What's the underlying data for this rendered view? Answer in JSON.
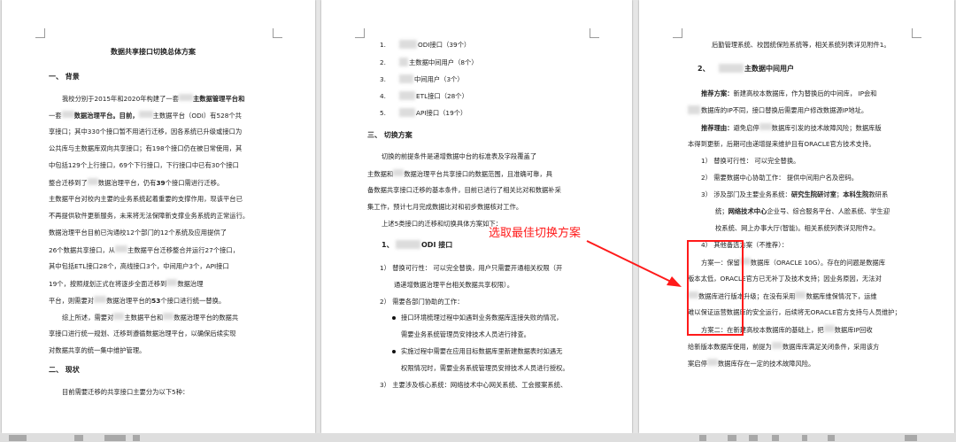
{
  "annotation": {
    "text": "选取最佳切换方案",
    "color": "#ff1a1a"
  },
  "page1": {
    "title": "数据共享接口切换总体方案",
    "s1_heading": "一、 背景",
    "p1": [
      "我校分别于2015年和2020年构建了一套",
      "主数据管理平台和",
      "一套",
      "数据治理平台。目前，",
      "主数据平台（ODI）有528个共",
      "享接口；其中330个接口暂不用进行迁移，因各系统已升级或接口为",
      "公共库与主数据库双向共享接口；有198个接口仍在被日常使用，其",
      "中包括129个上行接口，69个下行接口，下行接口中已有30个接口",
      "整合迁移到了",
      "数据治理平台，仍有",
      "39",
      "个接口需进行迁移。",
      "主数据平台对校内主要的业务系统起着重要的支撑作用，现该平台已",
      "不再提供软件更新服务，未来将无法保障新支撑业务系统的正常运行。",
      "数据治理平台目前已沟通校12个部门的12个系统及应用提供了",
      "26个数据共享接口，从",
      "主数据平台迁移整合并运行27个接口，",
      "其中包括ETL接口28个，高线接口3个，中间用户3个，API接口",
      "19个，按照规划正式在将逐步全面迁移到",
      "数据治理",
      "平台，则需要对",
      "数据治理平台的",
      "53",
      "个接口进行统一替换。"
    ],
    "p2": [
      "综上所述，需要对",
      "主数据平台和",
      "数据治理平台的数据共",
      "享接口进行统一规划、迁移到遵循数据治理平台，以确保后续实现",
      "对数据共享的统一集中维护管理。"
    ],
    "s2_heading": "二、 现状",
    "s2_line": "目前需要迁移的共享接口主要分为以下5种："
  },
  "page2": {
    "list": [
      {
        "n": "1.",
        "t": "ODI接口（39个）"
      },
      {
        "n": "2.",
        "t": "主数据中间用户（8个）"
      },
      {
        "n": "3.",
        "t": "中间用户（3个）"
      },
      {
        "n": "4.",
        "t": "ETL接口（28个）"
      },
      {
        "n": "5.",
        "t": "API接口（19个）"
      }
    ],
    "s3_heading": "三、 切换方案",
    "p1": [
      "切换的前提条件是递增数据中台的标准表及字段覆盖了",
      "主数据和",
      "数据治理平台共享接口的数据范围，且准确可靠，具",
      "备数据共享接口迁移的基本条件，目前已进行了相关比对和数据补采",
      "集工作，预计七月完成数据比对和初步数据核对工作。"
    ],
    "p2": "上述5类接口的迁移和切换具体方案如下：",
    "sub1": "1、",
    "sub1_title": "ODI 接口",
    "i1": [
      "1） 替换可行性： 可以完全替换，用户只需要开通相关权限（开",
      "通递增数据治理平台相关数据共享权限）。"
    ],
    "i2": "2） 需要各部门协助的工作：",
    "b1": [
      "接口环境梳理过程中如遇到业务数据库连接失败的情况，",
      "需要业务系统管理员安排技术人员进行排查。"
    ],
    "b2": [
      "实施过程中需要在应用目标数据库里新建数据表时如遇无",
      "权限情况时，需要业务系统管理员安排技术人员进行授权。"
    ],
    "i3": "3） 主要涉及核心系统：网络技术中心网关系统、工会报案系统、"
  },
  "page3": {
    "l0": "后勤管理系统、校园统保险系统等，相关系统列表详见附件1。",
    "sub2": "2、",
    "sub2_title": "主数据中间用户",
    "rec1_label": "推荐方案：",
    "rec1": [
      "新建高校本数据库，作为替换后的中间库， IP会和",
      "数据库的IP不同，接口替换后需要用户修改数据源IP地址。"
    ],
    "rec2_label": "推荐理由：",
    "rec2": [
      "避免启停",
      "数据库引发的技术故障风险；数据库版",
      "本得到更新，后期可由递增提来维护且有ORACLE官方技术支持。"
    ],
    "n1": "1） 替换可行性： 可以完全替换。",
    "n2": "2） 需要数据中心协助工作： 提供中间用户名及密码。",
    "n3": [
      "3） 涉及部门及主要业务系统：",
      "研究生院研讨室",
      "；",
      "本科生院",
      "教研系",
      "统；",
      "网络技术中心",
      "企业号、综合服务平台、人脸系统、学生迎",
      "校系统、网上办事大厅(智能)。相关系统列表详见附件2。"
    ],
    "n4": "4） 其他备选方案（不推荐）：",
    "alt1": [
      "方案一：保留",
      "数据库（ORACLE 10G）。存在的问题是数据库",
      "版本太低，ORACLE官方已无补丁及技术支持；因业务原因，无法对",
      "数据库进行版本升级；在没有采用",
      "数据库维保情况下，运维",
      "难以保证运营数据库的安全运行，后续将无ORACLE官方支持与人员维护；"
    ],
    "alt2": [
      "方案二：在新建高校本数据库的基础上，把",
      "数据库IP回收",
      "给新版本数据库使用，前提为",
      "数据库库满足关闭条件，采用该方",
      "案启停",
      "数据库存在一定的技术故障风险。"
    ]
  }
}
